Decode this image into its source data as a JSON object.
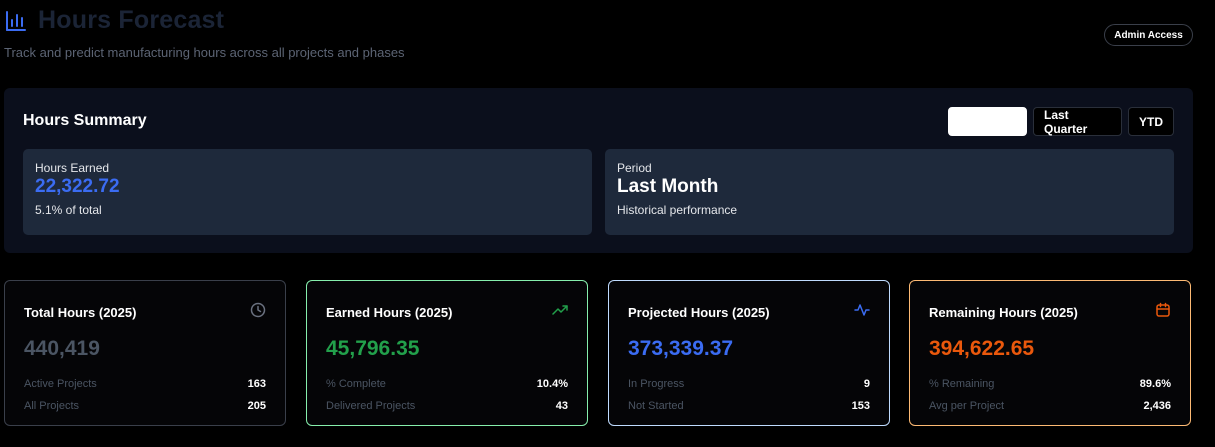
{
  "header": {
    "title": "Hours Forecast",
    "subtitle": "Track and predict manufacturing hours across all projects and phases",
    "admin_badge": "Admin Access"
  },
  "summary": {
    "title": "Hours Summary",
    "period_buttons": [
      "",
      "Last Quarter",
      "YTD"
    ],
    "earned_card": {
      "label": "Hours Earned",
      "value": "22,322.72",
      "note": "5.1% of total"
    },
    "period_card": {
      "label": "Period",
      "value": "Last Month",
      "note": "Historical performance"
    }
  },
  "stats": [
    {
      "title": "Total Hours (2025)",
      "value": "440,419",
      "icon": "clock-icon",
      "rows": [
        {
          "k": "Active Projects",
          "v": "163"
        },
        {
          "k": "All Projects",
          "v": "205"
        }
      ]
    },
    {
      "title": "Earned Hours (2025)",
      "value": "45,796.35",
      "icon": "trending-up-icon",
      "rows": [
        {
          "k": "% Complete",
          "v": "10.4%"
        },
        {
          "k": "Delivered Projects",
          "v": "43"
        }
      ]
    },
    {
      "title": "Projected Hours (2025)",
      "value": "373,339.37",
      "icon": "activity-icon",
      "rows": [
        {
          "k": "In Progress",
          "v": "9"
        },
        {
          "k": "Not Started",
          "v": "153"
        }
      ]
    },
    {
      "title": "Remaining Hours (2025)",
      "value": "394,622.65",
      "icon": "calendar-icon",
      "rows": [
        {
          "k": "% Remaining",
          "v": "89.6%"
        },
        {
          "k": "Avg per Project",
          "v": "2,436"
        }
      ]
    }
  ],
  "colors": {
    "accent_blue": "#3b6cf2",
    "green": "#22a04b",
    "orange": "#ea580c",
    "muted": "#4b5563"
  }
}
